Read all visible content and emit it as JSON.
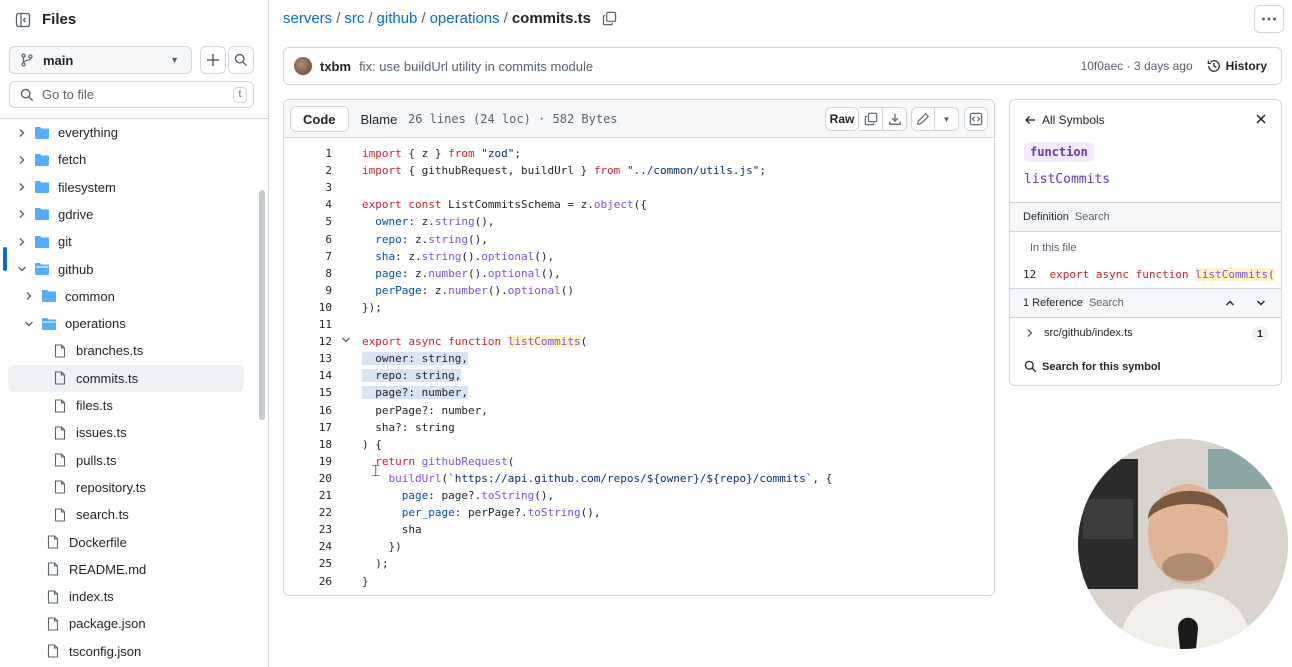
{
  "sidebar": {
    "title": "Files",
    "branch": "main",
    "goto_placeholder": "Go to file",
    "goto_shortcut": "t",
    "items": [
      {
        "label": "everything",
        "type": "folder",
        "expanded": false,
        "depth": 0
      },
      {
        "label": "fetch",
        "type": "folder",
        "expanded": false,
        "depth": 0
      },
      {
        "label": "filesystem",
        "type": "folder",
        "expanded": false,
        "depth": 0
      },
      {
        "label": "gdrive",
        "type": "folder",
        "expanded": false,
        "depth": 0
      },
      {
        "label": "git",
        "type": "folder",
        "expanded": false,
        "depth": 0
      },
      {
        "label": "github",
        "type": "folder",
        "expanded": true,
        "depth": 0
      },
      {
        "label": "common",
        "type": "folder",
        "expanded": false,
        "depth": 1
      },
      {
        "label": "operations",
        "type": "folder",
        "expanded": true,
        "depth": 1
      },
      {
        "label": "branches.ts",
        "type": "file",
        "depth": 2
      },
      {
        "label": "commits.ts",
        "type": "file",
        "depth": 2,
        "selected": true
      },
      {
        "label": "files.ts",
        "type": "file",
        "depth": 2
      },
      {
        "label": "issues.ts",
        "type": "file",
        "depth": 2
      },
      {
        "label": "pulls.ts",
        "type": "file",
        "depth": 2
      },
      {
        "label": "repository.ts",
        "type": "file",
        "depth": 2
      },
      {
        "label": "search.ts",
        "type": "file",
        "depth": 2
      },
      {
        "label": "Dockerfile",
        "type": "file",
        "depth": 1
      },
      {
        "label": "README.md",
        "type": "file",
        "depth": 1
      },
      {
        "label": "index.ts",
        "type": "file",
        "depth": 1
      },
      {
        "label": "package.json",
        "type": "file",
        "depth": 1
      },
      {
        "label": "tsconfig.json",
        "type": "file",
        "depth": 1
      }
    ]
  },
  "breadcrumb": {
    "parts": [
      "servers",
      "src",
      "github",
      "operations"
    ],
    "current": "commits.ts"
  },
  "commit": {
    "author": "txbm",
    "message": "fix: use buildUrl utility in commits module",
    "meta": "10f0aec · 3 days ago",
    "history_label": "History"
  },
  "code_toolbar": {
    "tab_code": "Code",
    "tab_blame": "Blame",
    "file_info": "26 lines (24 loc) · 582 Bytes",
    "raw_label": "Raw"
  },
  "code_lines": [
    "import { z } from \"zod\";",
    "import { githubRequest, buildUrl } from \"../common/utils.js\";",
    "",
    "export const ListCommitsSchema = z.object({",
    "  owner: z.string(),",
    "  repo: z.string(),",
    "  sha: z.string().optional(),",
    "  page: z.number().optional(),",
    "  perPage: z.number().optional()",
    "});",
    "",
    "export async function listCommits(",
    "  owner: string,",
    "  repo: string,",
    "  page?: number,",
    "  perPage?: number,",
    "  sha?: string",
    ") {",
    "  return githubRequest(",
    "    buildUrl(`https://api.github.com/repos/${owner}/${repo}/commits`, {",
    "      page: page?.toString(),",
    "      per_page: perPage?.toString(),",
    "      sha",
    "    })",
    "  );",
    "}"
  ],
  "symbols": {
    "back_label": "All Symbols",
    "kind": "function",
    "name": "listCommits",
    "definition_label": "Definition",
    "search_label": "Search",
    "in_this_file": "In this file",
    "def_line_no": "12",
    "def_code_prefix": "export async function ",
    "def_code_name": "listCommits(",
    "references_label": "1 Reference",
    "ref_path": "src/github/index.ts",
    "ref_count": "1",
    "search_symbol": "Search for this symbol"
  },
  "colors": {
    "accent": "#0969da",
    "keyword": "#cf222e",
    "string": "#0a3069",
    "function": "#8250df",
    "property": "#0550ae"
  }
}
